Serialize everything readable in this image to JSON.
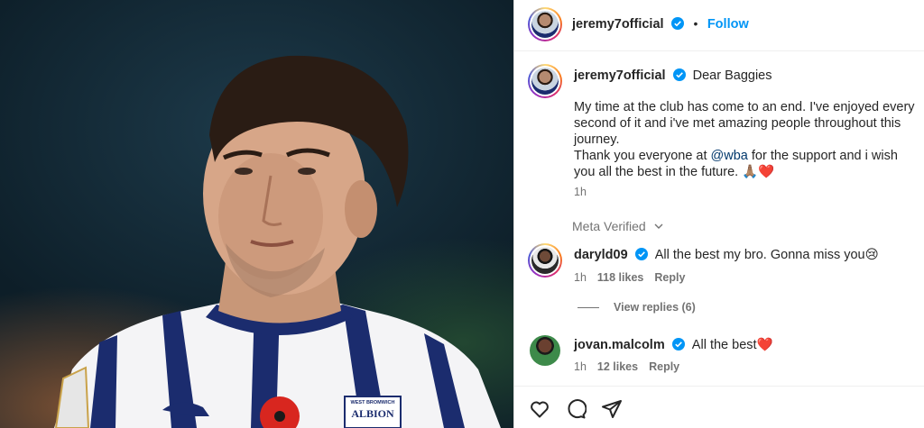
{
  "post": {
    "author": "jeremy7official",
    "follow_label": "Follow",
    "separator": "•",
    "caption_lead": "Dear Baggies",
    "caption_line1": "My time at the club has come to an end. I've enjoyed every second of it and i've met amazing people throughout this journey.",
    "caption_line2_pre": "Thank you everyone at ",
    "caption_mention": "@wba",
    "caption_line2_post": " for the support and i wish you all the best in the future. 🙏🏽❤️",
    "caption_time": "1h",
    "meta_verified": "Meta Verified"
  },
  "comments": [
    {
      "user": "daryld09",
      "text": "All the best my bro. Gonna miss you😢",
      "time": "1h",
      "likes": "118 likes",
      "reply": "Reply",
      "view_replies": "View replies (6)"
    },
    {
      "user": "jovan.malcolm",
      "text": "All the best❤️",
      "time": "1h",
      "likes": "12 likes",
      "reply": "Reply"
    }
  ],
  "photo": {
    "badge_line1": "WEST BROMWICH",
    "badge_line2": "ALBION"
  },
  "icons": {
    "like": "heart-icon",
    "comment": "comment-icon",
    "share": "share-icon",
    "verified": "verified-badge-icon",
    "chevron": "chevron-down-icon"
  },
  "colors": {
    "follow": "#0095f6",
    "verified": "#0095f6",
    "muted": "#737373",
    "mention": "#00376b"
  }
}
